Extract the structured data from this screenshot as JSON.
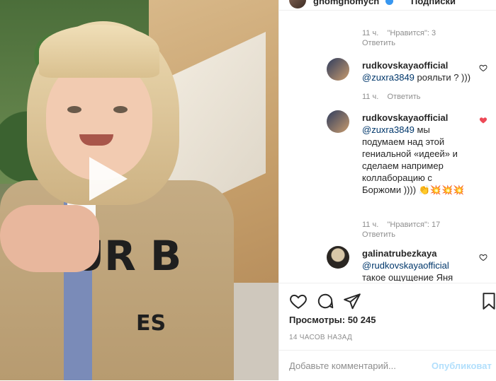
{
  "header": {
    "username": "gnomgnomych",
    "follow_label": "Подписки"
  },
  "comments": [
    {
      "kind": "meta",
      "time": "11 ч.",
      "likes": "\"Нравится\": 3",
      "reply": "Ответить"
    },
    {
      "kind": "comment",
      "user": "rudkovskayaofficial",
      "mention": "@zuxra3849",
      "text": " рояльти ? )))",
      "time": "11 ч.",
      "reply": "Ответить",
      "liked": false
    },
    {
      "kind": "comment",
      "user": "rudkovskayaofficial",
      "mention": "@zuxra3849",
      "text": " мы подумаем над этой гениальной «идеей» и сделаем например коллаборацию с Боржоми )))) 👏💥💥💥",
      "time": "11 ч.",
      "likes": "\"Нравится\": 17",
      "reply": "Ответить",
      "liked": true
    },
    {
      "kind": "comment",
      "user": "galinatrubezkaya",
      "mention": "@rudkovskayaofficial",
      "text": "такое ощущение Яня",
      "liked": false
    }
  ],
  "video": {
    "print_line1": "UR B",
    "print_line2": "ES"
  },
  "actions": {
    "views": "Просмотры: 50 245",
    "time_ago": "14 ЧАСОВ НАЗАД"
  },
  "add_comment": {
    "placeholder": "Добавьте комментарий...",
    "post_label": "Опубликоват"
  },
  "colors": {
    "accent": "#3897f0",
    "heart": "#ed4956",
    "mention": "#00376b"
  }
}
